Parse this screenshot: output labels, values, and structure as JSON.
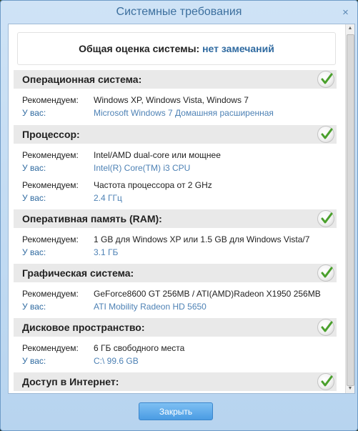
{
  "window": {
    "title": "Системные требования",
    "close_label": "×"
  },
  "summary": {
    "label": "Общая оценка системы:",
    "value": "нет замечаний"
  },
  "labels": {
    "recommended": "Рекомендуем:",
    "yours": "У вас:"
  },
  "sections": [
    {
      "title": "Операционная система:",
      "status": "ok",
      "rows": [
        {
          "recommended": "Windows XP, Windows Vista, Windows 7",
          "yours": "Microsoft Windows 7 Домашняя расширенная"
        }
      ]
    },
    {
      "title": "Процессор:",
      "status": "ok",
      "rows": [
        {
          "recommended": "Intel/AMD dual-core или мощнее",
          "yours": "Intel(R) Core(TM) i3 CPU"
        },
        {
          "recommended": "Частота процессора от 2 GHz",
          "yours": "2.4 ГГц"
        }
      ]
    },
    {
      "title": "Оперативная память (RAM):",
      "status": "ok",
      "rows": [
        {
          "recommended": "1 GB для Windows XP или 1.5 GB для Windows Vista/7",
          "yours": "3.1 ГБ"
        }
      ]
    },
    {
      "title": "Графическая система:",
      "status": "ok",
      "rows": [
        {
          "recommended": "GeForce8600 GT 256MB / ATI(AMD)Radeon X1950 256MB",
          "yours": "ATI Mobility Radeon HD 5650"
        }
      ]
    },
    {
      "title": "Дисковое пространство:",
      "status": "ok",
      "rows": [
        {
          "recommended": "6 ГБ свободного места",
          "yours": "C:\\ 99.6 GB"
        }
      ]
    },
    {
      "title": "Доступ в Интернет:",
      "status": "ok",
      "rows": []
    }
  ],
  "footer": {
    "close_button": "Закрыть"
  },
  "colors": {
    "accent": "#2f6aa0",
    "check": "#4aa02c",
    "button": "#4a9ce3"
  }
}
